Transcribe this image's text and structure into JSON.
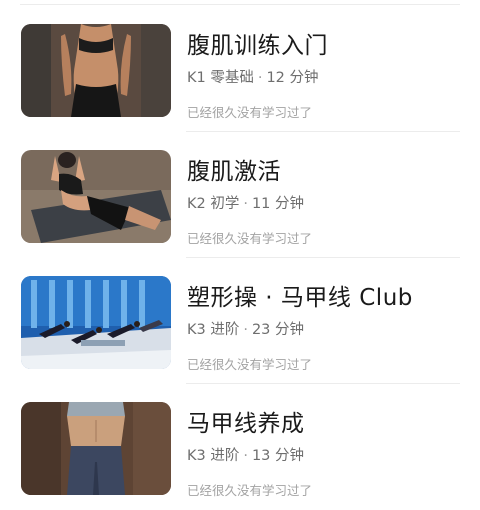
{
  "courses": [
    {
      "title": "腹肌训练入门",
      "level": "K1 零基础",
      "separator": "·",
      "duration": "12 分钟",
      "status": "已经很久没有学习过了",
      "thumbnail": "standing-torso-photo"
    },
    {
      "title": "腹肌激活",
      "level": "K2 初学",
      "separator": "·",
      "duration": "11 分钟",
      "status": "已经很久没有学习过了",
      "thumbnail": "floor-crunch-photo"
    },
    {
      "title": "塑形操 · 马甲线 Club",
      "level": "K3 进阶",
      "separator": "·",
      "duration": "23 分钟",
      "status": "已经很久没有学习过了",
      "thumbnail": "group-class-photo"
    },
    {
      "title": "马甲线养成",
      "level": "K3 进阶",
      "separator": "·",
      "duration": "13 分钟",
      "status": "已经很久没有学习过了",
      "thumbnail": "waist-closeup-photo"
    }
  ]
}
